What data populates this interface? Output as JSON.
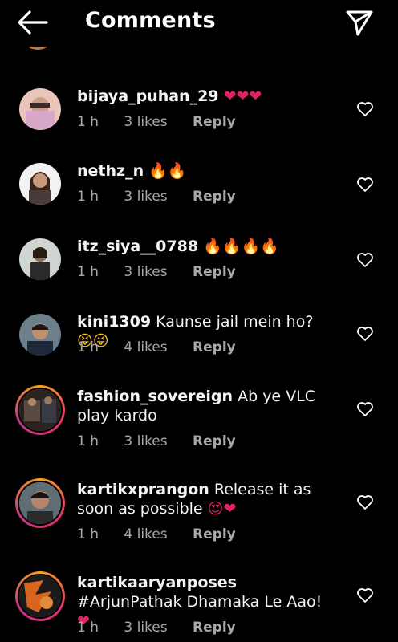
{
  "header": {
    "title": "Comments"
  },
  "colors": {
    "background": "#000000",
    "text": "#ffffff",
    "meta": "#a8a8a8",
    "heart": "#e0245e"
  },
  "comments": [
    {
      "username": "bijaya_puhan_29",
      "text": "",
      "emoji": "❤❤❤",
      "time": "1 h",
      "likes": "3 likes",
      "reply": "Reply"
    },
    {
      "username": "nethz_n",
      "text": "",
      "emoji": "🔥🔥",
      "time": "1 h",
      "likes": "3 likes",
      "reply": "Reply"
    },
    {
      "username": "itz_siya__0788",
      "text": "",
      "emoji": "🔥🔥🔥🔥",
      "time": "1 h",
      "likes": "3 likes",
      "reply": "Reply"
    },
    {
      "username": "kini1309",
      "text": "Kaunse jail mein ho?",
      "emoji": "😝😜",
      "time": "1 h",
      "likes": "4 likes",
      "reply": "Reply"
    },
    {
      "username": "fashion_sovereign",
      "text": "Ab ye VLC play kardo",
      "emoji": "",
      "time": "1 h",
      "likes": "3 likes",
      "reply": "Reply"
    },
    {
      "username": "kartikxprangon",
      "text": "Release it as soon as possible",
      "emoji": "😍❤",
      "time": "1 h",
      "likes": "4 likes",
      "reply": "Reply"
    },
    {
      "username": "kartikaaryanposes",
      "text": "#ArjunPathak Dhamaka Le Aao!",
      "emoji": "❤",
      "time": "1 h",
      "likes": "3 likes",
      "reply": "Reply"
    }
  ]
}
